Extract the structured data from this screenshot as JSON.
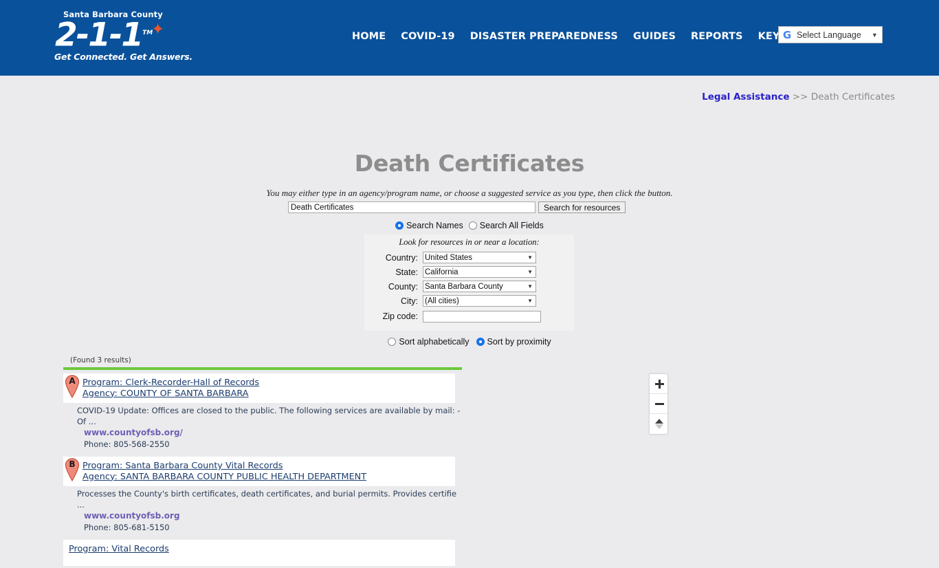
{
  "header": {
    "logo": {
      "county": "Santa Barbara County",
      "number": "2-1-1",
      "tm": "TM",
      "tagline": "Get Connected. Get Answers.",
      "star_icon": "star-icon"
    },
    "nav": [
      {
        "label": "HOME",
        "name": "nav-home"
      },
      {
        "label": "COVID-19",
        "name": "nav-covid19"
      },
      {
        "label": "DISASTER PREPAREDNESS",
        "name": "nav-disaster-preparedness"
      },
      {
        "label": "GUIDES",
        "name": "nav-guides"
      },
      {
        "label": "REPORTS",
        "name": "nav-reports"
      },
      {
        "label": "KEYWORD",
        "name": "nav-keyword"
      }
    ],
    "search_icon": "search-icon",
    "translate": {
      "icon": "google-g-icon",
      "label": "Select Language",
      "caret": "▼"
    },
    "brand_color": "#09519b"
  },
  "breadcrumb": {
    "parent": "Legal Assistance",
    "separator": ">>",
    "current": "Death Certificates",
    "link_color": "#2b20c9"
  },
  "page": {
    "title": "Death Certificates"
  },
  "search": {
    "hint": "You may either type in an agency/program name, or choose a suggested service as you type, then click the button.",
    "input_value": "Death Certificates",
    "input_placeholder": "",
    "button_label": "Search for resources",
    "scope_options": [
      {
        "label": "Search Names",
        "checked": true,
        "name": "radio-search-names"
      },
      {
        "label": "Search All Fields",
        "checked": false,
        "name": "radio-search-all-fields"
      }
    ]
  },
  "location": {
    "caption": "Look for resources in or near a location:",
    "fields": [
      {
        "label": "Country:",
        "value": "United States",
        "type": "select",
        "name": "country-select"
      },
      {
        "label": "State:",
        "value": "California",
        "type": "select",
        "name": "state-select"
      },
      {
        "label": "County:",
        "value": "Santa Barbara County",
        "type": "select",
        "name": "county-select"
      },
      {
        "label": "City:",
        "value": "(All cities)",
        "type": "select",
        "name": "city-select"
      },
      {
        "label": "Zip code:",
        "value": "",
        "type": "text",
        "name": "zipcode-input"
      }
    ],
    "caret": "▼"
  },
  "sort": {
    "options": [
      {
        "label": "Sort alphabetically",
        "checked": false,
        "name": "radio-sort-alphabetically"
      },
      {
        "label": "Sort by proximity",
        "checked": true,
        "name": "radio-sort-by-proximity"
      }
    ]
  },
  "results": {
    "count_text": "(Found 3 results)",
    "rule_color": "#6dc83c",
    "items": [
      {
        "marker": "A",
        "program": "Program: Clerk-Recorder-Hall of Records",
        "agency": "Agency: COUNTY OF SANTA BARBARA",
        "description": "COVID-19 Update: Offices are closed to the public. The following services are available by mail: -Of ...",
        "url": "www.countyofsb.org/",
        "phone": "Phone: 805-568-2550"
      },
      {
        "marker": "B",
        "program": "Program: Santa Barbara County Vital Records",
        "agency": "Agency: SANTA BARBARA COUNTY PUBLIC HEALTH DEPARTMENT",
        "description": "Processes the County's birth certificates, death certificates, and burial permits. Provides certifie ...",
        "url": "www.countyofsb.org",
        "phone": "Phone: 805-681-5150"
      },
      {
        "marker": "",
        "program": "Program: Vital Records",
        "agency": "",
        "description": "",
        "url": "",
        "phone": ""
      }
    ]
  },
  "map_controls": {
    "zoom_in": {
      "icon": "plus-icon",
      "label": "+"
    },
    "zoom_out": {
      "icon": "minus-icon",
      "label": "−"
    },
    "compass": {
      "icon": "compass-icon",
      "label": ""
    }
  }
}
